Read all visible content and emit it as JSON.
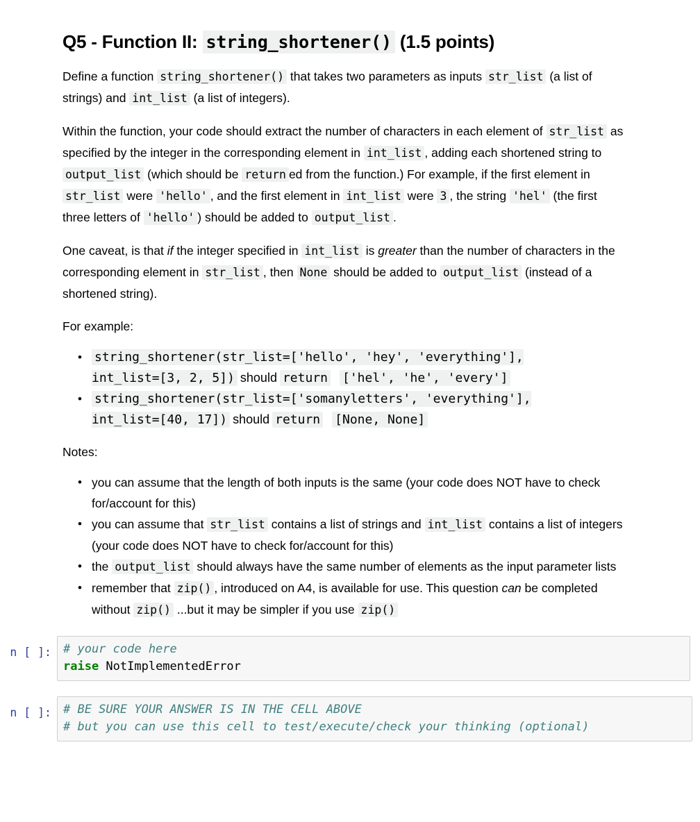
{
  "heading": {
    "prefix": "Q5 - Function II: ",
    "code": "string_shortener()",
    "suffix": " (1.5 points)"
  },
  "paragraph1": {
    "t1": "Define a function ",
    "c1": "string_shortener()",
    "t2": " that takes two parameters as inputs ",
    "c2": "str_list",
    "t3": " (a list of strings) and ",
    "c3": "int_list",
    "t4": " (a list of integers)."
  },
  "paragraph2": {
    "t1": "Within the function, your code should extract the number of characters in each element of ",
    "c1": "str_list",
    "t2": " as specified by the integer in the corresponding element in ",
    "c2": "int_list",
    "t3": ", adding each shortened string to ",
    "c3": "output_list",
    "t4": " (which should be ",
    "c4": "return",
    "t5": "ed from the function.) For example, if the first element in ",
    "c5": "str_list",
    "t6": " were ",
    "c6": "'hello'",
    "t7": ", and the first element in ",
    "c7": "int_list",
    "t8": " were ",
    "c8": "3",
    "t9": ", the string ",
    "c9": "'hel'",
    "t10": " (the first three letters of ",
    "c10": "'hello'",
    "t11": ") should be added to ",
    "c11": "output_list",
    "t12": "."
  },
  "paragraph3": {
    "t1": "One caveat, is that ",
    "em1": "if",
    "t2": " the integer specified in ",
    "c1": "int_list",
    "t3": " is ",
    "em2": "greater",
    "t4": " than the number of characters in the corresponding element in ",
    "c2": "str_list",
    "t5": ", then ",
    "c3": "None",
    "t6": " should be added to ",
    "c4": "output_list",
    "t7": " (instead of a shortened string)."
  },
  "for_example_label": "For example:",
  "examples": [
    {
      "call": "string_shortener(str_list=['hello', 'hey', 'everything'],\nint_list=[3, 2, 5])",
      "should": "should",
      "return_kw": "return",
      "result": "['hel', 'he', 'every']"
    },
    {
      "call": "string_shortener(str_list=['somanyletters', 'everything'],\nint_list=[40, 17])",
      "should": "should",
      "return_kw": "return",
      "result": "[None, None]"
    }
  ],
  "notes_label": "Notes:",
  "notes": [
    {
      "t1": "you can assume that the length of both inputs is the same (your code does NOT have to check for/account for this)"
    },
    {
      "t1": "you can assume that ",
      "c1": "str_list",
      "t2": " contains a list of strings and ",
      "c2": "int_list",
      "t3": " contains a list of integers (your code does NOT have to check for/account for this)"
    },
    {
      "t1": "the ",
      "c1": "output_list",
      "t2": " should always have the same number of elements as the input parameter lists"
    },
    {
      "t1": "remember that ",
      "c1": "zip()",
      "t2": ", introduced on A4, is available for use. This question ",
      "em1": "can",
      "t3": " be completed without ",
      "c2": "zip()",
      "t4": " ...but it may be simpler if you use ",
      "c3": "zip()"
    }
  ],
  "cells": [
    {
      "prompt": "n [ ]:",
      "lines": [
        {
          "comment": "# your code here"
        },
        {
          "keyword": "raise",
          "name": " NotImplementedError"
        }
      ]
    },
    {
      "prompt": "n [ ]:",
      "lines": [
        {
          "comment": "# BE SURE YOUR ANSWER IS IN THE CELL ABOVE"
        },
        {
          "comment": "# but you can use this cell to test/execute/check your thinking (optional)"
        }
      ]
    }
  ],
  "colors": {
    "inline_code_bg": "#eff0f0",
    "cell_bg": "#f7f7f7",
    "cell_border": "#cfcfcf",
    "prompt_blue": "#303f9f",
    "comment_teal": "#408080",
    "keyword_green": "#008000"
  }
}
